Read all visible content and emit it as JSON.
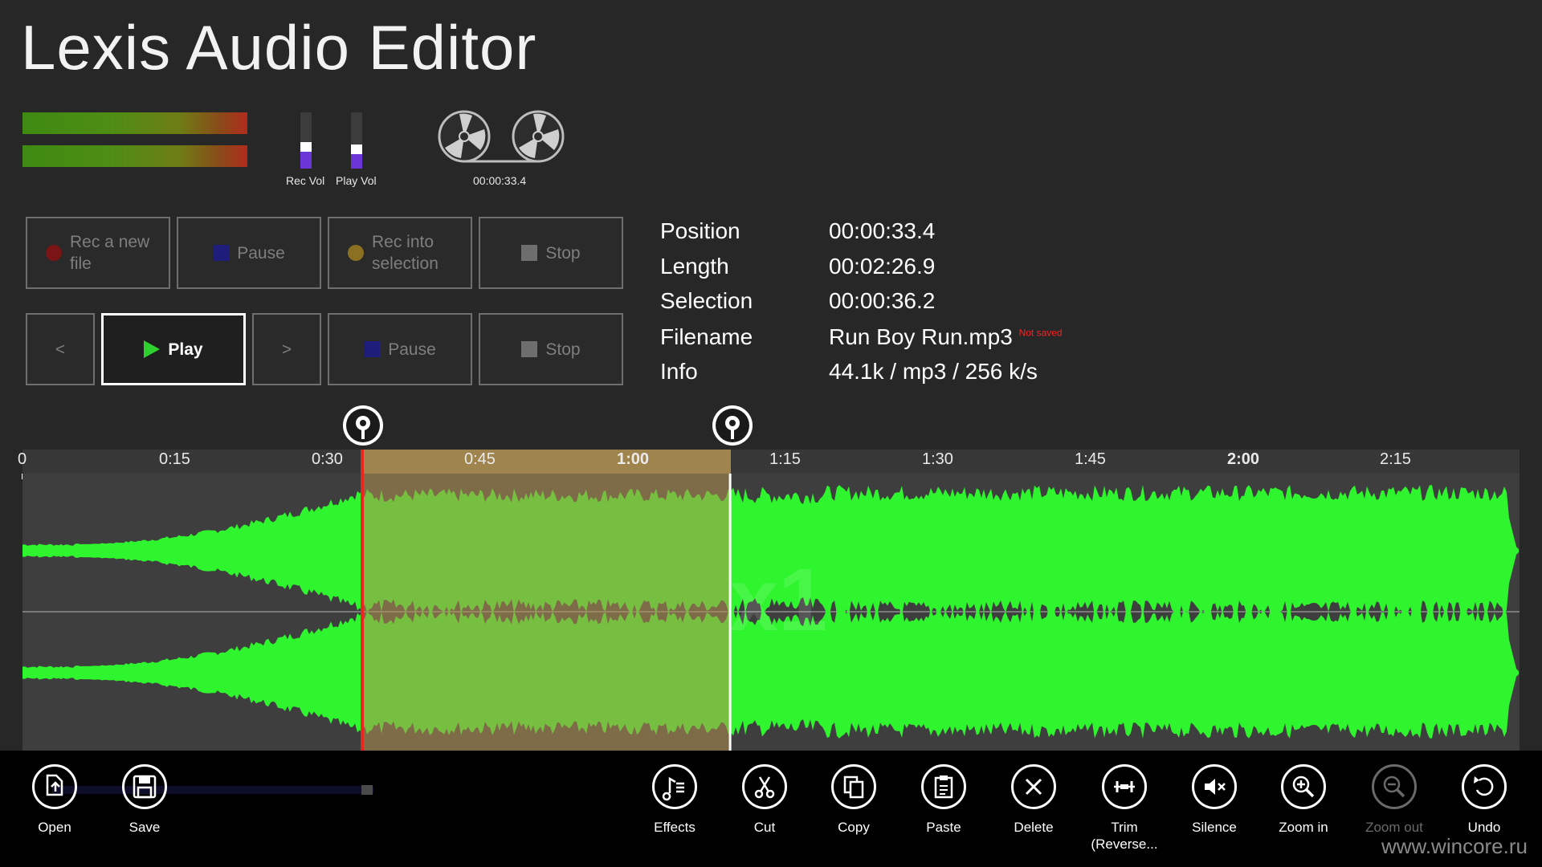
{
  "app": {
    "title": "Lexis Audio Editor"
  },
  "meters": {
    "rec_vol_label": "Rec Vol",
    "play_vol_label": "Play Vol",
    "rec_vol_level": 0.3,
    "play_vol_level": 0.25,
    "reel_time": "00:00:33.4"
  },
  "record_controls": [
    {
      "label": "Rec a new file",
      "icon": "record-dot-icon",
      "color": "#7a1515"
    },
    {
      "label": "Pause",
      "icon": "pause-square-icon",
      "color": "#1e1e7a"
    },
    {
      "label": "Rec into selection",
      "icon": "record-selection-dot-icon",
      "color": "#8a7020"
    },
    {
      "label": "Stop",
      "icon": "stop-square-icon",
      "color": "#6e6e6e"
    }
  ],
  "playback_controls": {
    "prev_label": "<",
    "play_label": "Play",
    "next_label": ">",
    "pause_label": "Pause",
    "stop_label": "Stop",
    "play_icon_color": "#2ed12e",
    "pause_icon_color": "#1e1e7a",
    "stop_icon_color": "#6e6e6e"
  },
  "info": {
    "position_label": "Position",
    "position_value": "00:00:33.4",
    "length_label": "Length",
    "length_value": "00:02:26.9",
    "selection_label": "Selection",
    "selection_value": "00:00:36.2",
    "filename_label": "Filename",
    "filename_value": "Run Boy Run.mp3",
    "not_saved": "Not saved",
    "info_label": "Info",
    "info_value": "44.1k / mp3 / 256 k/s"
  },
  "timeline": {
    "ticks": [
      "0",
      "0:15",
      "0:30",
      "0:45",
      "1:00",
      "1:15",
      "1:30",
      "1:45",
      "2:00",
      "2:15"
    ],
    "selection_start": "0:33.4",
    "selection_length": "0:36.2",
    "zoom_watermark": "x1",
    "waveform_color": "#2ef52e",
    "selection_color": "#b29252",
    "playhead_color": "#e8281e"
  },
  "appbar": {
    "left": [
      {
        "label": "Open",
        "icon": "open-file-icon"
      },
      {
        "label": "Save",
        "icon": "save-disk-icon"
      }
    ],
    "right": [
      {
        "label": "Effects",
        "icon": "music-effects-icon"
      },
      {
        "label": "Cut",
        "icon": "scissors-icon"
      },
      {
        "label": "Copy",
        "icon": "copy-icon"
      },
      {
        "label": "Paste",
        "icon": "paste-clipboard-icon"
      },
      {
        "label": "Delete",
        "icon": "delete-x-icon"
      },
      {
        "label": "Trim (Reverse...",
        "icon": "trim-icon"
      },
      {
        "label": "Silence",
        "icon": "mute-speaker-icon"
      },
      {
        "label": "Zoom in",
        "icon": "zoom-in-icon"
      },
      {
        "label": "Zoom out",
        "icon": "zoom-out-icon"
      },
      {
        "label": "Undo",
        "icon": "undo-icon"
      }
    ],
    "watermark": "www.wincore.ru"
  }
}
